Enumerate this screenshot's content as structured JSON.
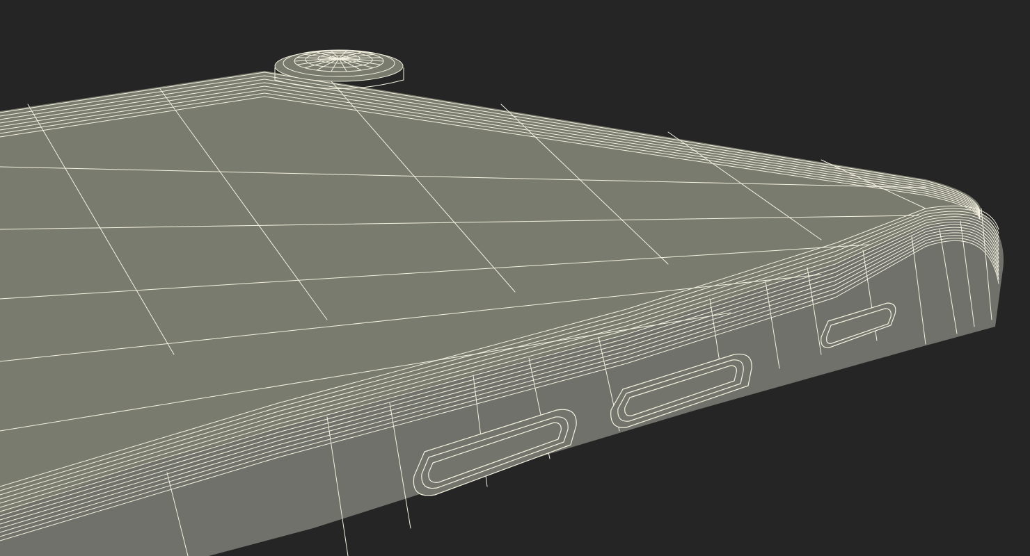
{
  "scene": {
    "subject": "wireframe-render",
    "colors": {
      "background": "#252525",
      "surface": "#7a7b6f",
      "edge": "#70716a",
      "wire": "#f4f2e0"
    }
  }
}
